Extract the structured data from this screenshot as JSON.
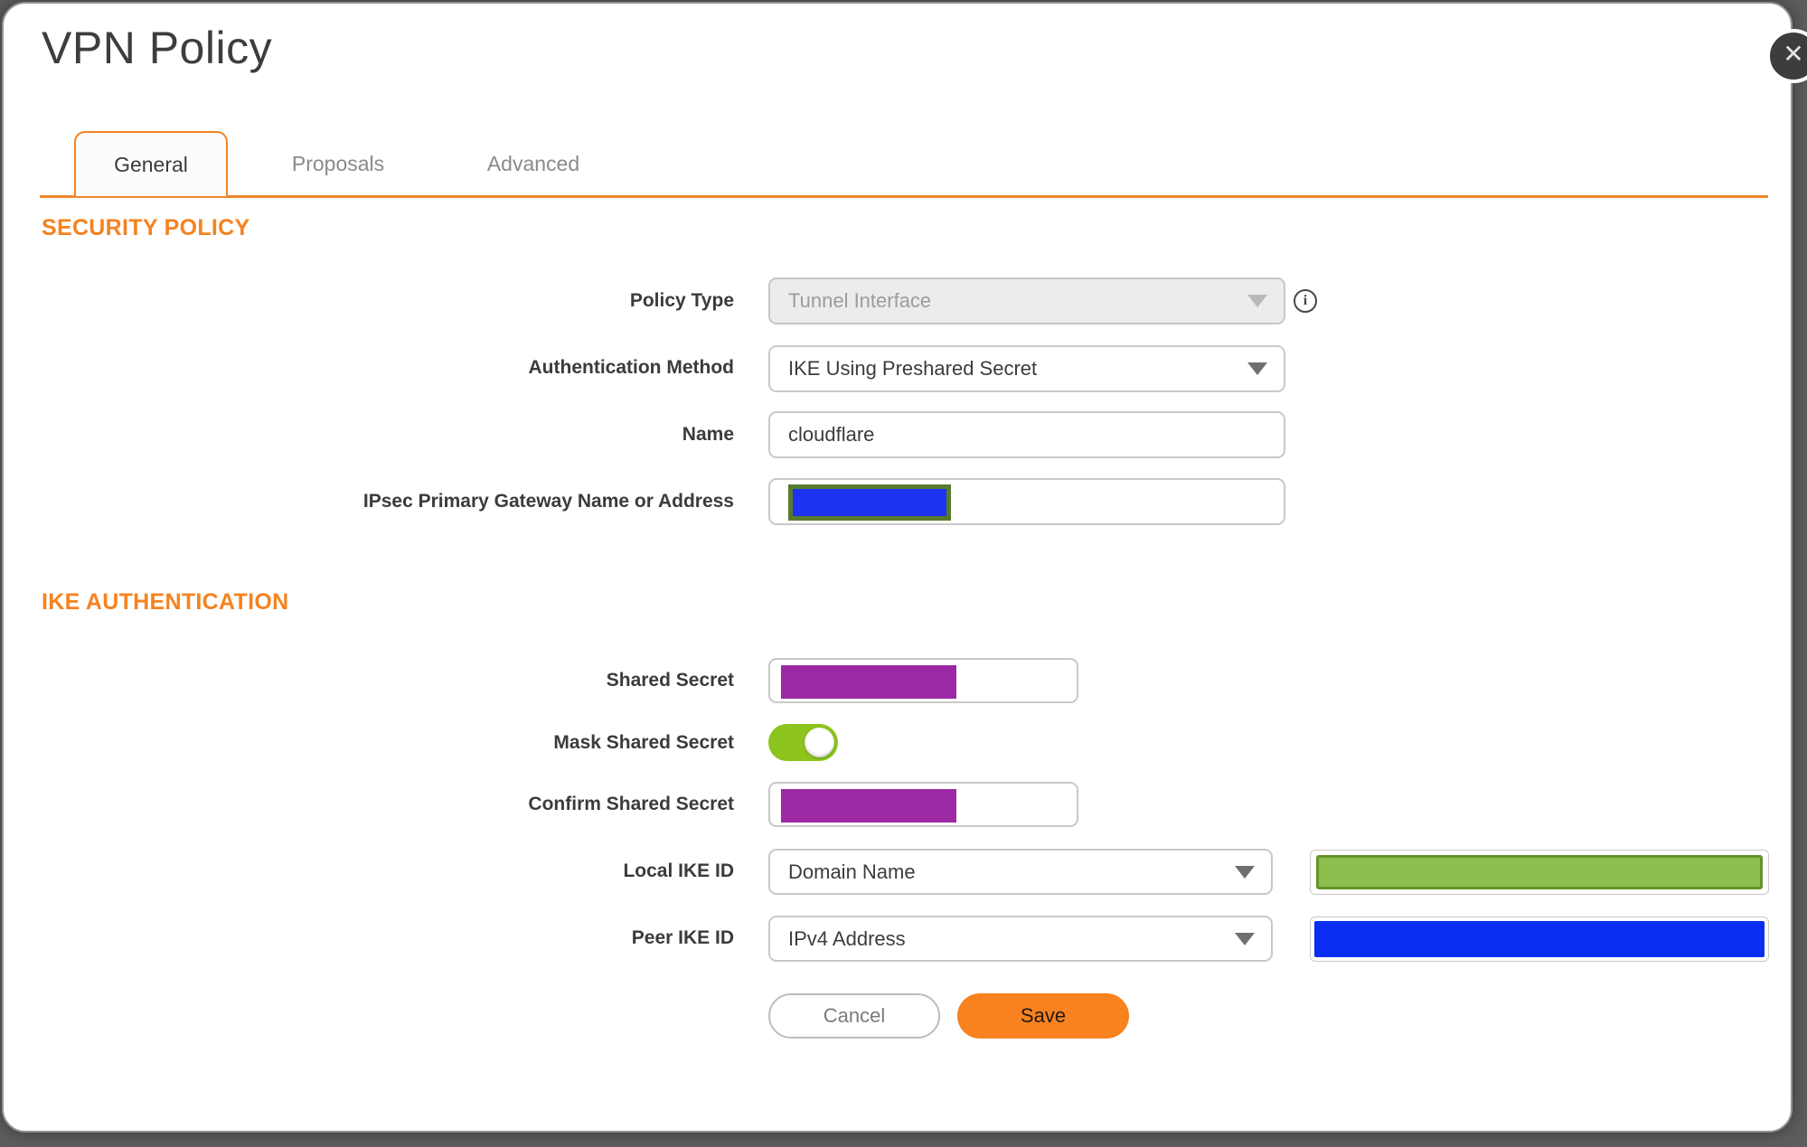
{
  "dialog": {
    "title": "VPN Policy"
  },
  "icons": {
    "close": "✕",
    "info": "i"
  },
  "tabs": [
    {
      "label": "General",
      "active": true
    },
    {
      "label": "Proposals",
      "active": false
    },
    {
      "label": "Advanced",
      "active": false
    }
  ],
  "sections": {
    "security_policy": "SECURITY POLICY",
    "ike_authentication": "IKE AUTHENTICATION"
  },
  "fields": {
    "policy_type": {
      "label": "Policy Type",
      "value": "Tunnel Interface",
      "disabled": true
    },
    "authentication_method": {
      "label": "Authentication Method",
      "value": "IKE Using Preshared Secret"
    },
    "name": {
      "label": "Name",
      "value": "cloudflare"
    },
    "gateway": {
      "label": "IPsec Primary Gateway Name or Address",
      "value": "",
      "redaction": "blue box with green border"
    },
    "shared_secret": {
      "label": "Shared Secret",
      "redaction": "purple box"
    },
    "mask_shared_secret": {
      "label": "Mask Shared Secret",
      "toggle_state": "on"
    },
    "confirm_shared_secret": {
      "label": "Confirm Shared Secret",
      "redaction": "purple box"
    },
    "local_ike_id": {
      "label": "Local IKE ID",
      "value": "Domain Name",
      "id_redaction": "green box"
    },
    "peer_ike_id": {
      "label": "Peer IKE ID",
      "value": "IPv4 Address",
      "id_redaction": "blue box"
    }
  },
  "buttons": {
    "cancel": "Cancel",
    "save": "Save"
  },
  "colors": {
    "accent_orange": "#f6821f",
    "save_button": "#f8821f",
    "toggle_on_green": "#8cc41d",
    "redact_purple": "#9c28a3",
    "redact_blue": "#0c2ef3",
    "redact_green_fill": "#8cbf4e",
    "redact_green_border": "#649427",
    "gateway_blue": "#1e33f2",
    "gateway_green_border": "#577a2d",
    "page_background": "#5d5d5d",
    "label_text": "#3b3b3b"
  }
}
